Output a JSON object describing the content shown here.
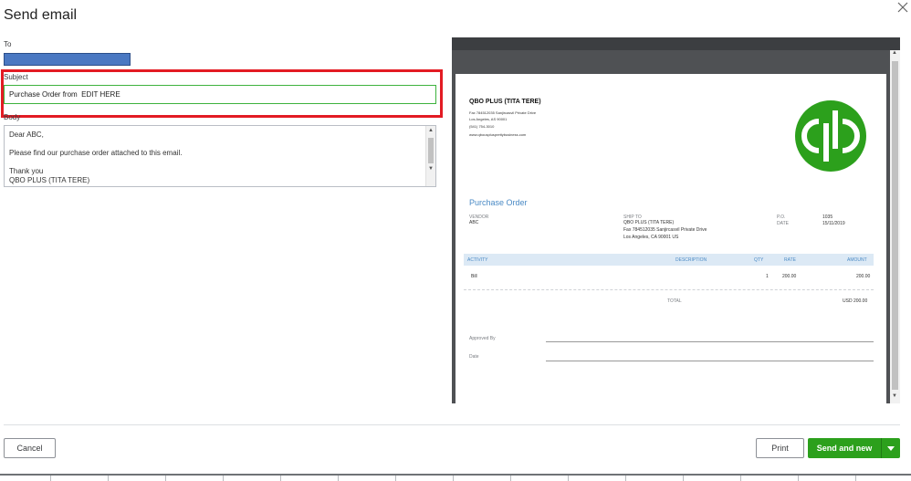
{
  "dialog": {
    "title": "Send email",
    "close_icon": "close-icon"
  },
  "form": {
    "to_label": "To",
    "subject_label": "Subject",
    "subject_value": "Purchase Order from  EDIT HERE",
    "body_label": "Body",
    "body_value": "Dear ABC,\n\nPlease find our purchase order attached to this email.\n\nThank you\nQBO PLUS (TITA TERE)"
  },
  "preview": {
    "company_name": "QBO PLUS (TITA TERE)",
    "company_address": "Fax 784512035 Sanjircasvil Private Drive",
    "company_city": "Los Angeles, AS  90001",
    "company_phone": "(541) 754-3010",
    "company_web": "www.qbousplusprettybusiness.com",
    "doc_title": "Purchase Order",
    "vendor_label": "VENDOR",
    "vendor_value": "ABC",
    "ship_to_label": "SHIP TO",
    "ship_to_name": "QBO PLUS (TITA TERE)",
    "ship_to_address": "Fax 784512035 Sanjircasvil Private Drive",
    "ship_to_city": "Los Angeles, CA  90001 US",
    "po_label": "P.O.",
    "po_value": "1035",
    "date_label": "DATE",
    "date_value": "15/11/2019",
    "columns": {
      "activity": "ACTIVITY",
      "description": "DESCRIPTION",
      "qty": "QTY",
      "rate": "RATE",
      "amount": "AMOUNT"
    },
    "line_items": [
      {
        "activity": "Bill",
        "description": "",
        "qty": "1",
        "rate": "200.00",
        "amount": "200.00"
      }
    ],
    "total_label": "TOTAL",
    "total_value": "USD 200.00",
    "approved_by_label": "Approved By",
    "date_sign_label": "Date",
    "logo_icon": "quickbooks-logo-icon"
  },
  "footer": {
    "cancel_label": "Cancel",
    "print_label": "Print",
    "send_label": "Send and new",
    "send_dropdown_icon": "caret-down-icon"
  },
  "colors": {
    "highlight": "#e31b23",
    "accent_green": "#2ca01c",
    "to_field": "#4a78c2",
    "doc_blue": "#4a8ac5"
  }
}
